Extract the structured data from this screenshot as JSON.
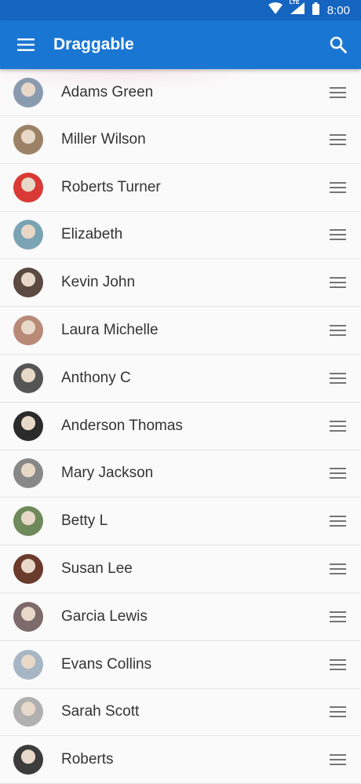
{
  "status": {
    "time": "8:00",
    "network": "LTE"
  },
  "appbar": {
    "title": "Draggable"
  },
  "contacts": [
    {
      "name": "Adams Green",
      "color": "#8a9bb0"
    },
    {
      "name": "Miller Wilson",
      "color": "#9b8266"
    },
    {
      "name": "Roberts Turner",
      "color": "#d93a35"
    },
    {
      "name": "Elizabeth",
      "color": "#7aa3b3"
    },
    {
      "name": "Kevin John",
      "color": "#5a4a42"
    },
    {
      "name": "Laura Michelle",
      "color": "#b98a78"
    },
    {
      "name": "Anthony C",
      "color": "#555555"
    },
    {
      "name": "Anderson Thomas",
      "color": "#2b2b2b"
    },
    {
      "name": "Mary Jackson",
      "color": "#888888"
    },
    {
      "name": "Betty L",
      "color": "#6f8a5a"
    },
    {
      "name": "Susan Lee",
      "color": "#6a3a2a"
    },
    {
      "name": "Garcia Lewis",
      "color": "#7d6a6a"
    },
    {
      "name": "Evans Collins",
      "color": "#a7b6c4"
    },
    {
      "name": "Sarah Scott",
      "color": "#b0b0b0"
    },
    {
      "name": "Roberts",
      "color": "#3c3c3c"
    }
  ]
}
